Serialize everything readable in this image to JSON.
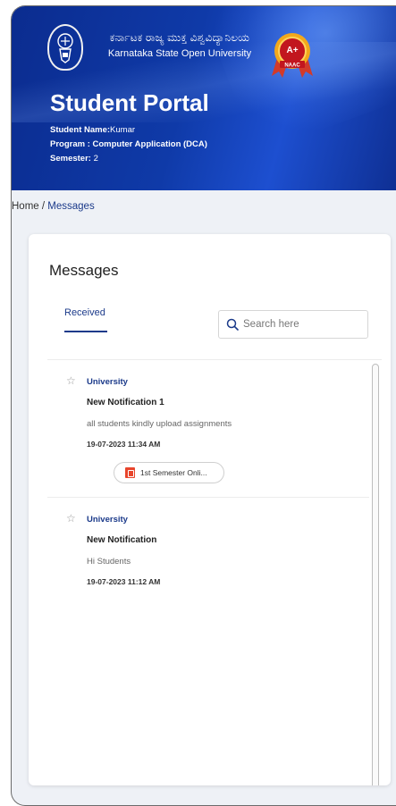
{
  "header": {
    "university_name_kannada": "ಕರ್ನಾಟಕ ರಾಜ್ಯ ಮುಕ್ತ ವಿಶ್ವವಿದ್ಯಾನಿಲಯ",
    "university_name_english": "Karnataka State Open University",
    "accreditation_badge": "A+",
    "accreditation_label": "NAAC",
    "portal_title": "Student Portal",
    "student_name_label": "Student Name:",
    "student_name": "Kumar",
    "program_text": "Program : Computer Application (DCA)",
    "semester_label": "Semester:",
    "semester_value": "2"
  },
  "breadcrumb": {
    "home": "Home",
    "separator": " / ",
    "current": "Messages"
  },
  "messages_page": {
    "title": "Messages",
    "tab_received": "Received",
    "search_placeholder": "Search here",
    "items": [
      {
        "sender": "University",
        "subject": "New Notification 1",
        "body": "all students kindly upload assignments",
        "date": "19-07-2023 11:34 AM",
        "attachment": "1st Semester Onli..."
      },
      {
        "sender": "University",
        "subject": "New Notification",
        "body": "Hi Students",
        "date": "19-07-2023 11:12 AM"
      }
    ]
  },
  "colors": {
    "header_blue": "#0f3aa8",
    "link_blue": "#1b3a8a",
    "pdf_red": "#e8452c"
  }
}
